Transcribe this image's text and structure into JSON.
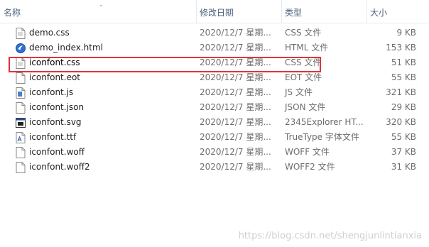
{
  "columns": {
    "name": "名称",
    "date": "修改日期",
    "type": "类型",
    "size": "大小"
  },
  "files": [
    {
      "name": "demo.css",
      "date": "2020/12/7 星期...",
      "type": "CSS 文件",
      "size": "9 KB",
      "icon": "css-file-icon"
    },
    {
      "name": "demo_index.html",
      "date": "2020/12/7 星期...",
      "type": "HTML 文件",
      "size": "153 KB",
      "icon": "browser-html-icon"
    },
    {
      "name": "iconfont.css",
      "date": "2020/12/7 星期...",
      "type": "CSS 文件",
      "size": "51 KB",
      "icon": "css-file-icon"
    },
    {
      "name": "iconfont.eot",
      "date": "2020/12/7 星期...",
      "type": "EOT 文件",
      "size": "55 KB",
      "icon": "blank-file-icon"
    },
    {
      "name": "iconfont.js",
      "date": "2020/12/7 星期...",
      "type": "JS 文件",
      "size": "321 KB",
      "icon": "script-file-icon"
    },
    {
      "name": "iconfont.json",
      "date": "2020/12/7 星期...",
      "type": "JSON 文件",
      "size": "29 KB",
      "icon": "blank-file-icon"
    },
    {
      "name": "iconfont.svg",
      "date": "2020/12/7 星期...",
      "type": "2345Explorer HT...",
      "size": "320 KB",
      "icon": "svg-file-icon"
    },
    {
      "name": "iconfont.ttf",
      "date": "2020/12/7 星期...",
      "type": "TrueType 字体文件",
      "size": "55 KB",
      "icon": "font-file-icon"
    },
    {
      "name": "iconfont.woff",
      "date": "2020/12/7 星期...",
      "type": "WOFF 文件",
      "size": "37 KB",
      "icon": "blank-file-icon"
    },
    {
      "name": "iconfont.woff2",
      "date": "2020/12/7 星期...",
      "type": "WOFF2 文件",
      "size": "31 KB",
      "icon": "blank-file-icon"
    }
  ],
  "watermark": "https://blog.csdn.net/shengjunlintianxia",
  "highlight_color": "#e0333a"
}
